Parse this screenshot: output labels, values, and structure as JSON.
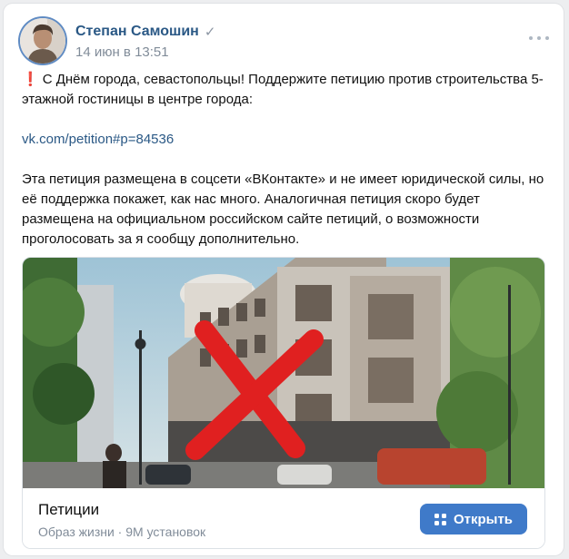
{
  "post": {
    "author": "Степан Самошин",
    "verified_icon": "check-icon",
    "date": "14 июн в 13:51",
    "menu_icon": "more-horizontal-icon",
    "text": {
      "excl_icon": "❗",
      "line1": "С Днём города, севастопольцы! Поддержите петицию против строительства 5-этажной гостиницы в центре города:",
      "link": "vk.com/petition#p=84536",
      "line3": "Эта петиция размещена в соцсети «ВКонтакте» и не имеет юридической силы, но её поддержка покажет, как нас много. Аналогичная петиция скоро будет размещена на официальном российском сайте петиций, о возможности проголосовать за я сообщу дополнительно."
    }
  },
  "attachment": {
    "image": "hotel-rendering-crossed-out",
    "app": {
      "title": "Петиции",
      "subtitle": "Образ жизни · 9M установок",
      "button_label": "Открыть",
      "button_icon": "grid-icon",
      "button_color": "#3f7ac9"
    }
  },
  "colors": {
    "link": "#2a5885",
    "muted": "#818c99",
    "cross": "#e02020"
  }
}
